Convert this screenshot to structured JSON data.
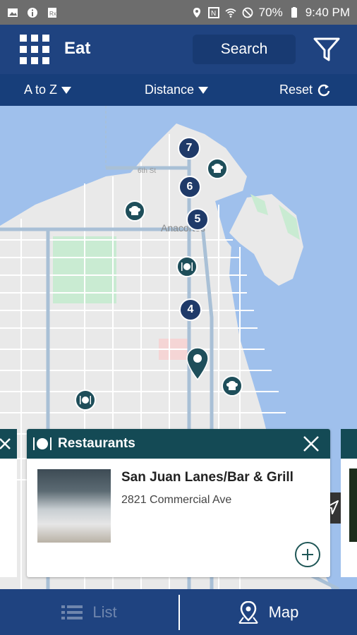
{
  "status_bar": {
    "battery": "70%",
    "time": "9:40 PM"
  },
  "header": {
    "title": "Eat",
    "search_label": "Search"
  },
  "sort_bar": {
    "az_label": "A to Z",
    "distance_label": "Distance",
    "reset_label": "Reset"
  },
  "map": {
    "street_label": "6th St",
    "town_label": "Anacortes",
    "markers": [
      "7",
      "6",
      "5",
      "4"
    ]
  },
  "card": {
    "category": "Restaurants",
    "name": "San Juan Lanes/Bar & Grill",
    "address": "2821 Commercial Ave"
  },
  "tabs": {
    "list_label": "List",
    "map_label": "Map"
  },
  "colors": {
    "header": "#1f4380",
    "card_header": "#144a55",
    "marker": "#1f3a69"
  }
}
